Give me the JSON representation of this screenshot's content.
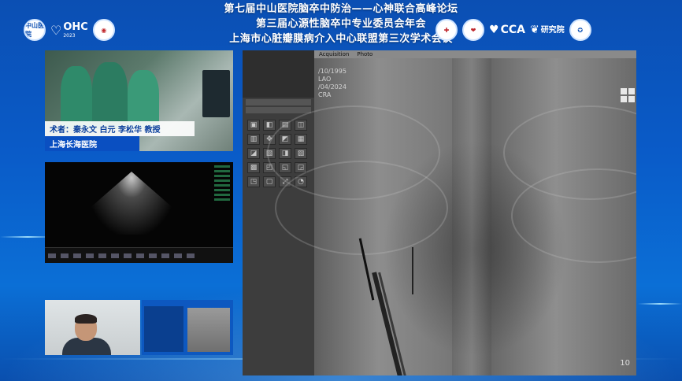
{
  "header": {
    "title_line1": "第七届中山医院脑卒中防治——心神联合高峰论坛",
    "title_line2": "第三届心源性脑卒中专业委员会年会",
    "title_line3": "上海市心脏瓣膜病介入中心联盟第三次学术会议",
    "left_logos": {
      "logo1_text": "中山医院",
      "ohc_text": "OHC",
      "ohc_sub": "2023"
    },
    "right_logos": {
      "cca_text": "CCA",
      "institute_text": "研究院"
    }
  },
  "surgery_caption": {
    "surgeons": "术者：秦永文 白元 李松华 教授",
    "hospital": "上海长海医院"
  },
  "angio": {
    "tabs": [
      "Acquisition",
      "Photo"
    ],
    "patient_dob": "/10/1995",
    "patient_date": "/04/2024",
    "lao_label": "LAO",
    "cran_label": "CRA",
    "frame_number": "10"
  }
}
